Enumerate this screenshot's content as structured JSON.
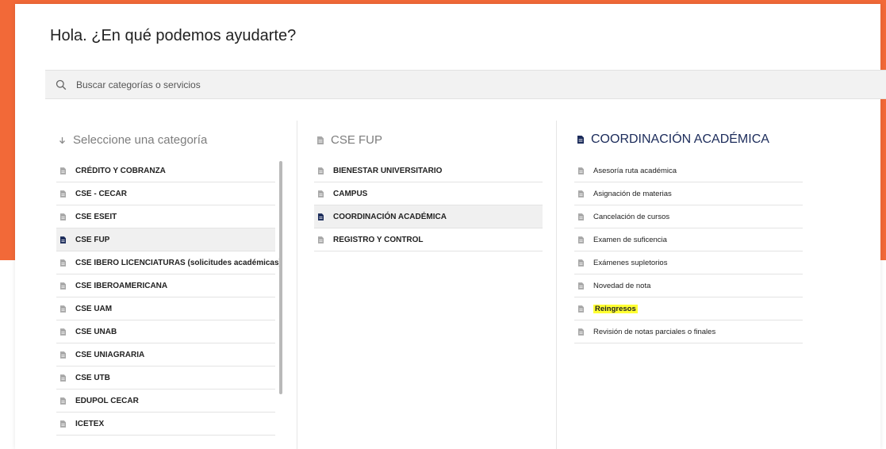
{
  "greeting": "Hola. ¿En qué podemos ayudarte?",
  "search": {
    "placeholder": "Buscar categorías o servicios",
    "icon": "search-icon"
  },
  "columns": {
    "categories": {
      "header": "Seleccione una categoría",
      "header_icon": "arrow-down-icon",
      "items": [
        {
          "label": "CRÉDITO Y COBRANZA",
          "selected": false
        },
        {
          "label": "CSE - CECAR",
          "selected": false
        },
        {
          "label": "CSE ESEIT",
          "selected": false
        },
        {
          "label": "CSE FUP",
          "selected": true
        },
        {
          "label": "CSE IBERO LICENCIATURAS (solicitudes académicas)",
          "selected": false
        },
        {
          "label": "CSE IBEROAMERICANA",
          "selected": false
        },
        {
          "label": "CSE UAM",
          "selected": false
        },
        {
          "label": "CSE UNAB",
          "selected": false
        },
        {
          "label": "CSE UNIAGRARIA",
          "selected": false
        },
        {
          "label": "CSE UTB",
          "selected": false
        },
        {
          "label": "EDUPOL CECAR",
          "selected": false
        },
        {
          "label": "ICETEX",
          "selected": false
        }
      ]
    },
    "subcategories": {
      "header": "CSE FUP",
      "items": [
        {
          "label": "BIENESTAR UNIVERSITARIO",
          "selected": false
        },
        {
          "label": "CAMPUS",
          "selected": false
        },
        {
          "label": "COORDINACIÓN ACADÉMICA",
          "selected": true
        },
        {
          "label": "REGISTRO Y CONTROL",
          "selected": false
        }
      ]
    },
    "services": {
      "header": "COORDINACIÓN ACADÉMICA",
      "items": [
        {
          "label": "Asesoría ruta académica",
          "highlighted": false
        },
        {
          "label": "Asignación de materias",
          "highlighted": false
        },
        {
          "label": "Cancelación de cursos",
          "highlighted": false
        },
        {
          "label": "Examen de suficencia",
          "highlighted": false
        },
        {
          "label": "Exámenes supletorios",
          "highlighted": false
        },
        {
          "label": "Novedad de nota",
          "highlighted": false
        },
        {
          "label": "Reingresos",
          "highlighted": true
        },
        {
          "label": "Revisión de notas parciales o finales",
          "highlighted": false
        }
      ]
    }
  },
  "colors": {
    "brand_orange": "#f26938",
    "selected_icon": "#1b2b5a",
    "muted_icon": "#a8a8a8",
    "highlight": "#ffff33"
  }
}
